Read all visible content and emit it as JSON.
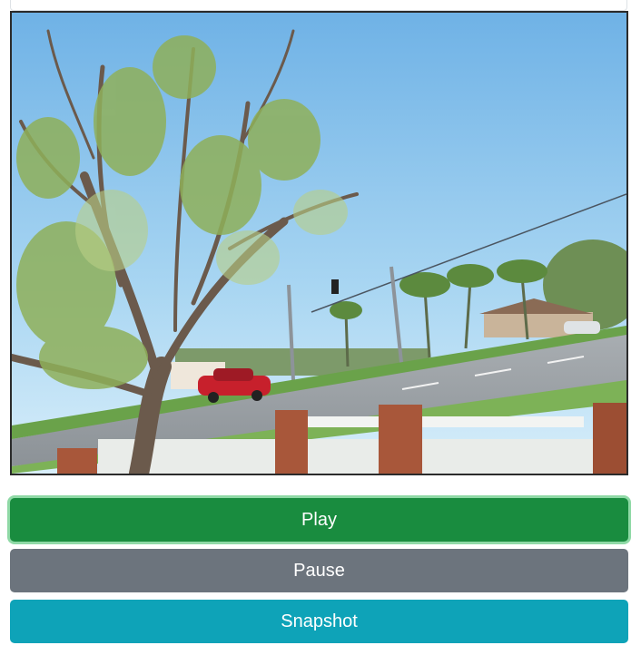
{
  "player": {
    "video_description_icon": "street-scene-video-frame"
  },
  "controls": {
    "play_label": "Play",
    "pause_label": "Pause",
    "snapshot_label": "Snapshot"
  },
  "colors": {
    "play": "#198c3f",
    "play_focus_ring": "#8fd9a6",
    "pause": "#6c747d",
    "snapshot": "#0ea3b8",
    "frame_border": "#2b2b2b"
  }
}
